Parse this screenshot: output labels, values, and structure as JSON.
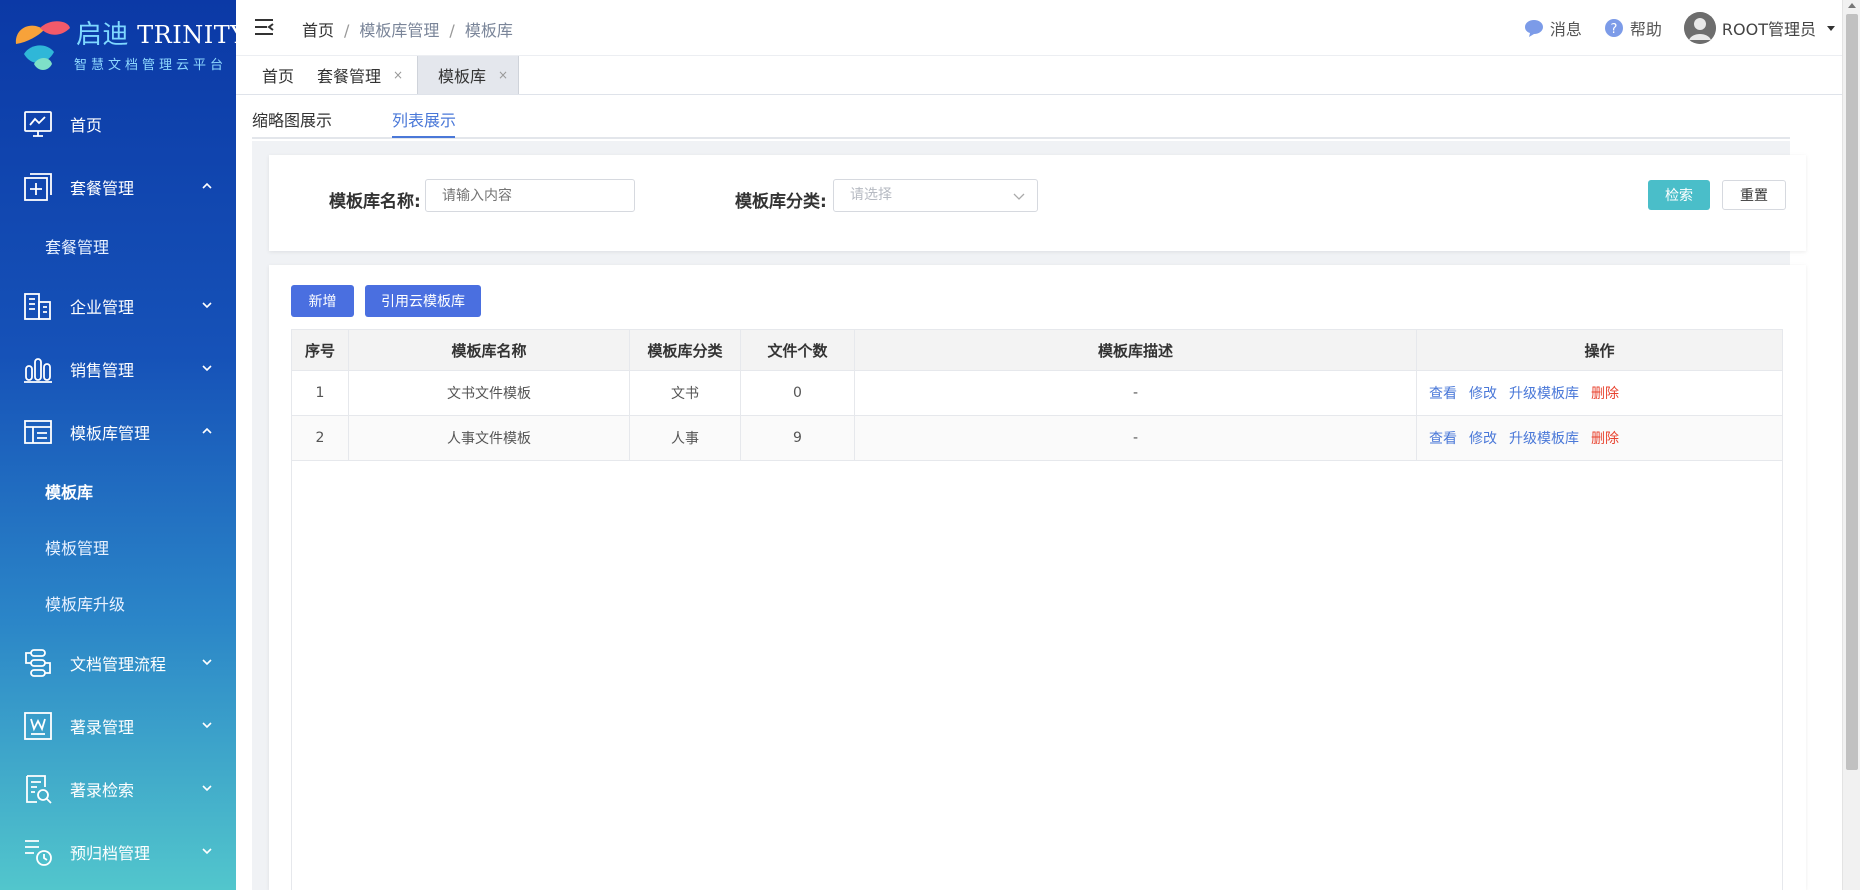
{
  "app": {
    "logo_cn": "启迪",
    "logo_en": "TRINITY",
    "logo_sub": "智慧文档管理云平台"
  },
  "sidebar": {
    "items": [
      {
        "label": "首页",
        "icon": "monitor-chart-icon"
      },
      {
        "label": "套餐管理",
        "icon": "plus-box-icon",
        "expanded": true
      },
      {
        "label": "套餐管理",
        "sub": true
      },
      {
        "label": "企业管理",
        "icon": "building-icon"
      },
      {
        "label": "销售管理",
        "icon": "bar-chart-icon"
      },
      {
        "label": "模板库管理",
        "icon": "layout-icon",
        "expanded": true
      },
      {
        "label": "模板库",
        "sub": true,
        "active": true
      },
      {
        "label": "模板管理",
        "sub": true
      },
      {
        "label": "模板库升级",
        "sub": true
      },
      {
        "label": "文档管理流程",
        "icon": "flow-icon"
      },
      {
        "label": "著录管理",
        "icon": "word-doc-icon"
      },
      {
        "label": "著录检索",
        "icon": "doc-search-icon"
      },
      {
        "label": "预归档管理",
        "icon": "clock-list-icon"
      }
    ]
  },
  "header": {
    "breadcrumb": [
      "首页",
      "模板库管理",
      "模板库"
    ],
    "sep": "/",
    "messages_label": "消息",
    "help_label": "帮助",
    "user_name": "ROOT管理员"
  },
  "tabs": [
    {
      "label": "首页"
    },
    {
      "label": "套餐管理",
      "close": "×"
    },
    {
      "label": "模板库",
      "close": "×",
      "active": true
    }
  ],
  "view_tabs": [
    "缩略图展示",
    "列表展示"
  ],
  "active_view_tab": 1,
  "search": {
    "name_label": "模板库名称:",
    "name_placeholder": "请输入内容",
    "category_label": "模板库分类:",
    "category_placeholder": "请选择",
    "search_button": "检索",
    "reset_button": "重置"
  },
  "actions": {
    "add_button": "新增",
    "cite_button": "引用云模板库"
  },
  "table": {
    "columns": [
      "序号",
      "模板库名称",
      "模板库分类",
      "文件个数",
      "模板库描述",
      "操作"
    ],
    "rows": [
      {
        "index": "1",
        "name": "文书文件模板",
        "category": "文书",
        "count": "0",
        "desc": "-"
      },
      {
        "index": "2",
        "name": "人事文件模板",
        "category": "人事",
        "count": "9",
        "desc": "-"
      }
    ],
    "ops": [
      "查看",
      "修改",
      "升级模板库",
      "删除"
    ]
  },
  "colors": {
    "accent": "#4a78d8",
    "search_btn": "#4abec9",
    "primary_btn": "#4a6fe0",
    "delete": "#e8432f"
  }
}
